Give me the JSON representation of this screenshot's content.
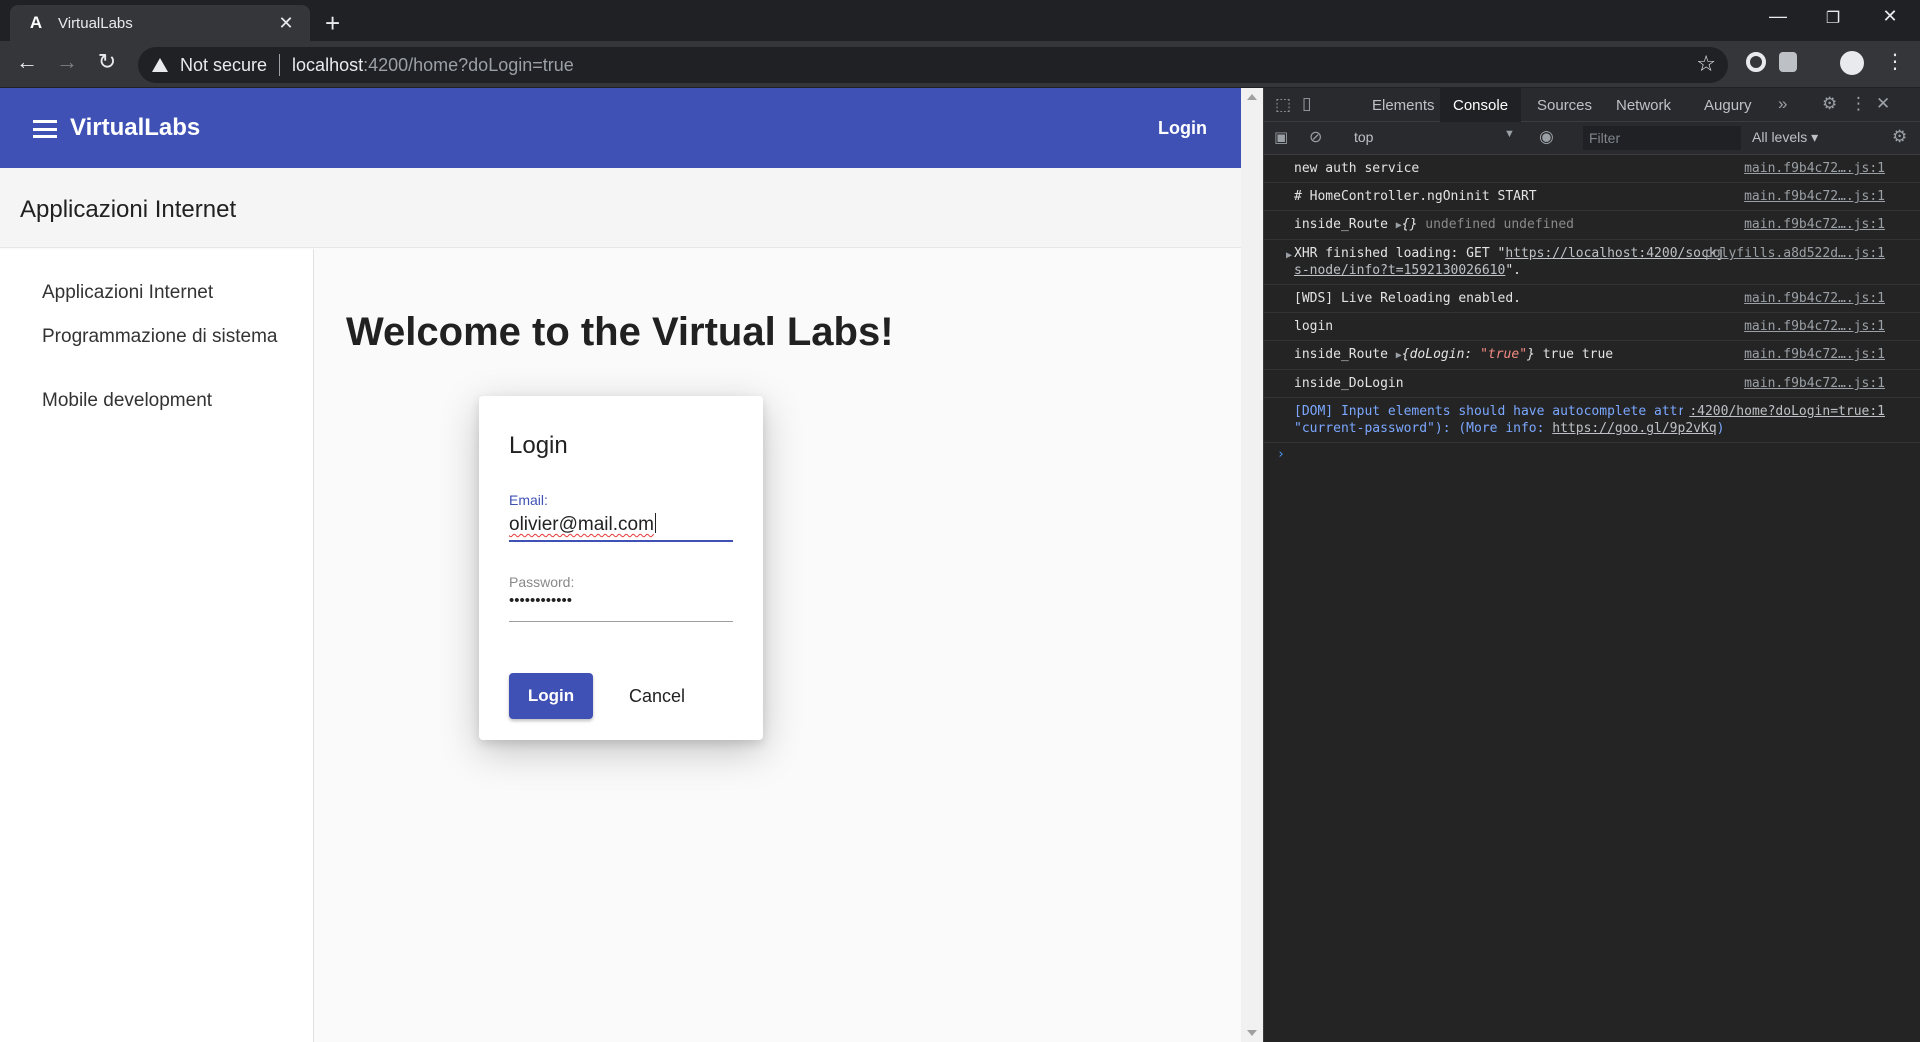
{
  "browser": {
    "tab_title": "VirtualLabs",
    "tab_favicon": "A",
    "security_label": "Not secure",
    "url_host": "localhost",
    "url_rest": ":4200/home?doLogin=true"
  },
  "app": {
    "title": "VirtualLabs",
    "header_login": "Login",
    "subheader_title": "Applicazioni Internet",
    "nav_items": [
      "Applicazioni Internet",
      "Programmazione di sistema",
      "Mobile development"
    ],
    "welcome": "Welcome to the Virtual Labs!",
    "primary_color": "#3f51b5"
  },
  "dialog": {
    "title": "Login",
    "email_label": "Email:",
    "email_value": "olivier@mail.com",
    "password_label": "Password:",
    "password_value": "••••••••••••",
    "login_button": "Login",
    "cancel_button": "Cancel"
  },
  "devtools": {
    "tabs": [
      "Elements",
      "Console",
      "Sources",
      "Network",
      "Augury"
    ],
    "active_tab": "Console",
    "context": "top",
    "filter_placeholder": "Filter",
    "levels": "All levels",
    "logs": [
      {
        "msg": "new auth service",
        "src": "main.f9b4c72….js:1"
      },
      {
        "msg": "# HomeController.ngOninit START",
        "src": "main.f9b4c72….js:1"
      },
      {
        "msg": "inside_Route",
        "obj": "{}",
        "extra": "undefined undefined",
        "src": "main.f9b4c72….js:1"
      },
      {
        "msg": "XHR finished loading: GET \"",
        "link": "https://localhost:4200/sockjs-node/info?t=1592130026610",
        "tail": "\".",
        "src": "polyfills.a8d522d….js:1"
      },
      {
        "msg": "[WDS] Live Reloading enabled.",
        "src": "main.f9b4c72….js:1"
      },
      {
        "msg": "login",
        "src": "main.f9b4c72….js:1"
      },
      {
        "msg": "inside_Route",
        "obj_key": "doLogin:",
        "obj_val": "\"true\"",
        "extra": "true true",
        "src": "main.f9b4c72….js:1"
      },
      {
        "msg": "inside_DoLogin",
        "src": "main.f9b4c72….js:1"
      },
      {
        "msg": "[DOM] Input elements should have autocomplete attributes (suggested: \"current-password\"): (More info: ",
        "link": "https://goo.gl/9p2vKq",
        "tail": ")",
        "src": ":4200/home?doLogin=true:1"
      }
    ]
  }
}
